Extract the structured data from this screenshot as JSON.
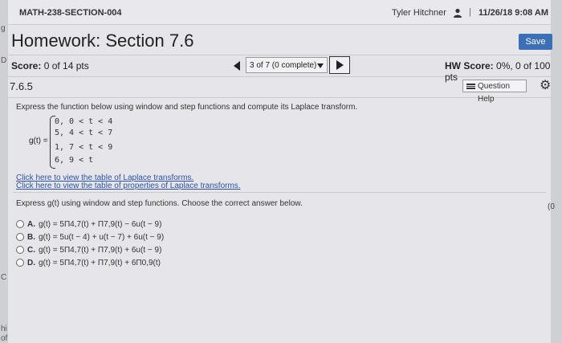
{
  "header": {
    "course": "MATH-238-SECTION-004",
    "user": "Tyler Hitchner",
    "separator": "|",
    "datetime": "11/26/18 9:08 AM"
  },
  "title": {
    "text": "Homework: Section 7.6",
    "save_label": "Save"
  },
  "scorebar": {
    "score_label": "Score:",
    "score_value": "0 of 14 pts",
    "question_nav": "3 of 7 (0 complete)",
    "hw_label": "HW Score:",
    "hw_value": "0%, 0 of 100 pts"
  },
  "question": {
    "number": "7.6.5",
    "help_label": "Question Help",
    "prompt": "Express the function below using window and step functions and compute its Laplace transform.",
    "function_label": "g(t) =",
    "pieces": [
      "0,  0 < t < 4",
      "5,  4 < t < 7",
      "1,  7 < t < 9",
      "6,     9 < t"
    ],
    "link1": "Click here to view the table of Laplace transforms.",
    "link2": "Click here to view the table of properties of Laplace transforms.",
    "instruction": "Express g(t) using window and step functions. Choose the correct answer below.",
    "options": [
      {
        "letter": "A.",
        "text": "g(t) = 5Π4,7(t) + Π7,9(t) − 6u(t − 9)"
      },
      {
        "letter": "B.",
        "text": "g(t) = 5u(t − 4) + u(t − 7) + 6u(t − 9)"
      },
      {
        "letter": "C.",
        "text": "g(t) = 5Π4,7(t) + Π7,9(t) + 6u(t − 9)"
      },
      {
        "letter": "D.",
        "text": "g(t) = 5Π4,7(t) + Π7,9(t) + 6Π0,9(t)"
      }
    ]
  },
  "edges": {
    "left_top": "g",
    "left_mid1": "D",
    "left_mid2": "C",
    "left_bottom1": "hi",
    "left_bottom2": "of",
    "right_frag": "(0"
  },
  "colors": {
    "save_button": "#3b6fb6",
    "link": "#2d52a8"
  }
}
